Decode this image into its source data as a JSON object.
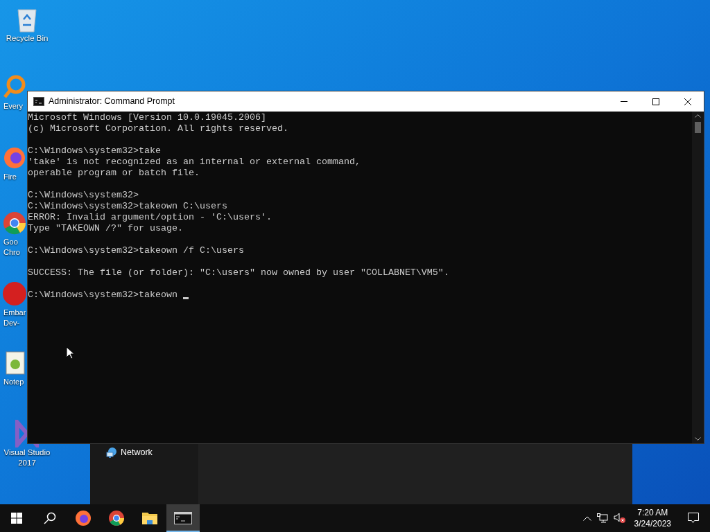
{
  "desktop_icons": [
    {
      "kind": "recycle",
      "lines": [
        "Recycle Bin"
      ]
    },
    {
      "kind": "everything",
      "lines": [
        "Every"
      ]
    },
    {
      "kind": "firefox",
      "lines": [
        "Fire"
      ]
    },
    {
      "kind": "chrome",
      "lines": [
        "Goo",
        "Chro"
      ]
    },
    {
      "kind": "embarcadero",
      "lines": [
        "Embar",
        "Dev-"
      ]
    },
    {
      "kind": "notepad",
      "lines": [
        "Notep"
      ]
    },
    {
      "kind": "visualstudio",
      "lines": [
        "Visual Studio",
        "2017"
      ]
    }
  ],
  "background_window": {
    "nav_items": [
      "Network"
    ]
  },
  "console": {
    "title": "Administrator: Command Prompt",
    "blocks": [
      [
        "Microsoft Windows [Version 10.0.19045.2006]",
        "(c) Microsoft Corporation. All rights reserved."
      ],
      [
        "C:\\Windows\\system32>take",
        "'take' is not recognized as an internal or external command,",
        "operable program or batch file."
      ],
      [
        "C:\\Windows\\system32>",
        "C:\\Windows\\system32>takeown C:\\users",
        "ERROR: Invalid argument/option - 'C:\\users'.",
        "Type \"TAKEOWN /?\" for usage."
      ],
      [
        "C:\\Windows\\system32>takeown /f C:\\users"
      ],
      [
        "SUCCESS: The file (or folder): \"C:\\users\" now owned by user \"COLLABNET\\VM5\"."
      ],
      [
        "C:\\Windows\\system32>takeown "
      ]
    ],
    "cursor": true
  },
  "taskbar": {
    "apps": [
      {
        "kind": "start",
        "selected": false
      },
      {
        "kind": "search",
        "selected": false
      },
      {
        "kind": "firefox",
        "selected": false
      },
      {
        "kind": "chrome",
        "selected": false
      },
      {
        "kind": "explorer",
        "selected": false
      },
      {
        "kind": "console",
        "selected": true
      }
    ],
    "time": "7:20 AM",
    "date": "3/24/2023"
  }
}
